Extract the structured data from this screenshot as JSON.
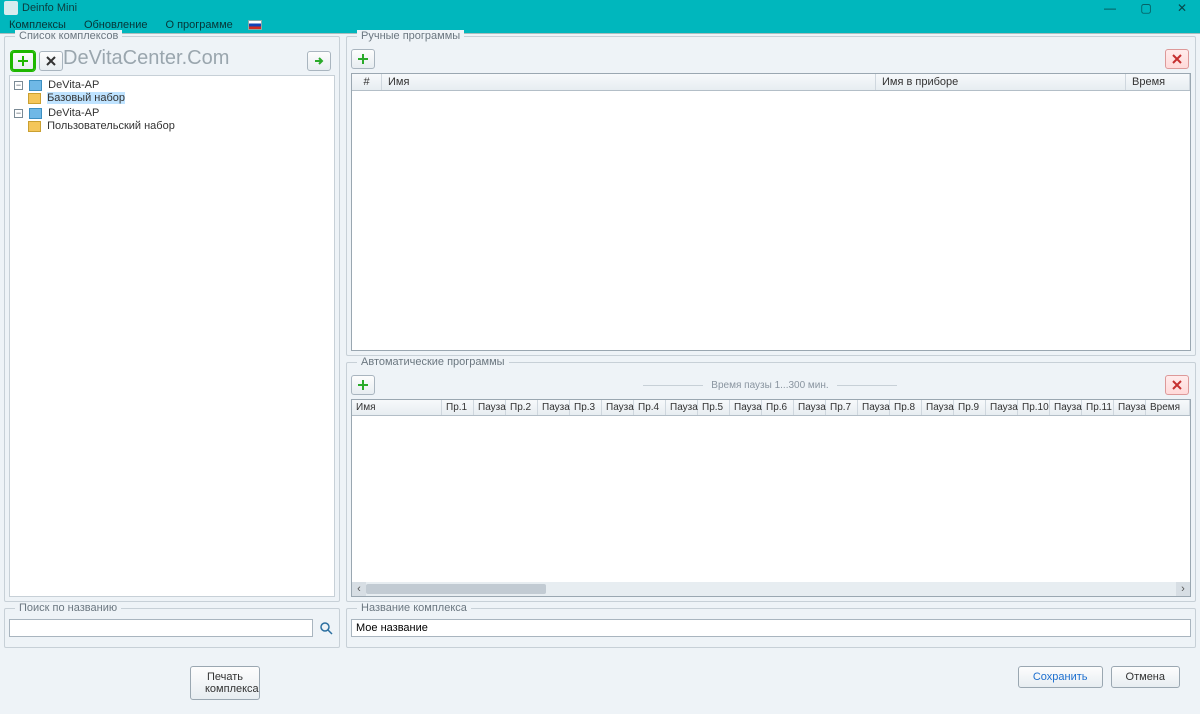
{
  "window": {
    "title": "Deinfo Mini"
  },
  "menu": {
    "complexes": "Комплексы",
    "update": "Обновление",
    "about": "О программе"
  },
  "watermark": "DeVitaCenter.Com",
  "left": {
    "group_title": "Список комплексов",
    "tree": {
      "n1": "DeVita-AP",
      "n1a": "Базовый набор",
      "n2": "DeVita-AP",
      "n2a": "Пользовательский набор"
    },
    "search_group_title": "Поиск по названию",
    "search_placeholder": ""
  },
  "manual": {
    "group_title": "Ручные программы",
    "col_num": "#",
    "col_name": "Имя",
    "col_device": "Имя в приборе",
    "col_time": "Время"
  },
  "auto": {
    "group_title": "Автоматические программы",
    "pause_hint": "Время паузы 1...300 мин.",
    "col_name": "Имя",
    "pr": "Пр.",
    "pause": "Пауза",
    "time": "Время"
  },
  "name_group": {
    "title": "Название комплекса",
    "value": "Мое название"
  },
  "buttons": {
    "print": "Печать комплекса",
    "save": "Сохранить",
    "cancel": "Отмена"
  }
}
